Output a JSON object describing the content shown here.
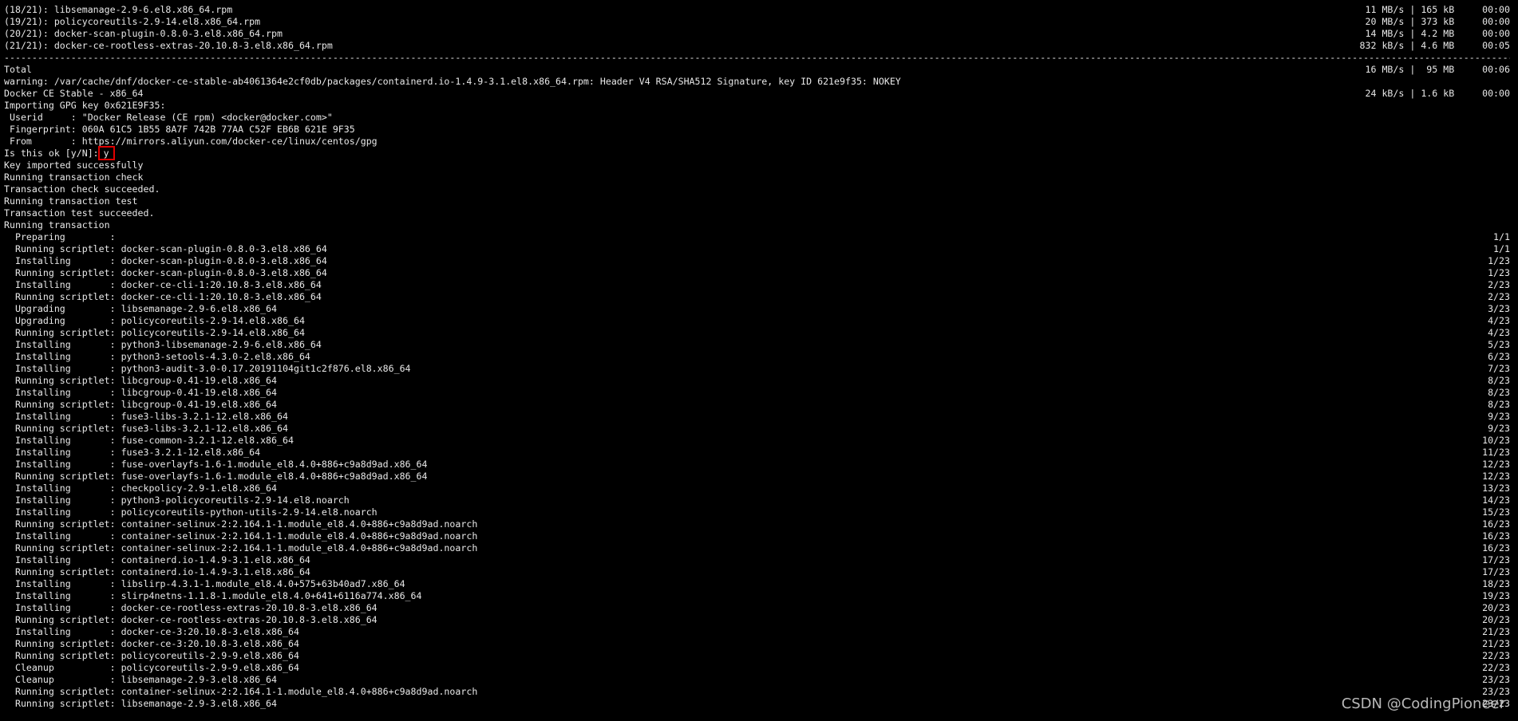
{
  "terminal": {
    "lines": [
      {
        "left": "(18/21): libsemanage-2.9-6.el8.x86_64.rpm",
        "right": "11 MB/s | 165 kB     00:00"
      },
      {
        "left": "(19/21): policycoreutils-2.9-14.el8.x86_64.rpm",
        "right": "20 MB/s | 373 kB     00:00"
      },
      {
        "left": "(20/21): docker-scan-plugin-0.8.0-3.el8.x86_64.rpm",
        "right": "14 MB/s | 4.2 MB     00:00"
      },
      {
        "left": "(21/21): docker-ce-rootless-extras-20.10.8-3.el8.x86_64.rpm",
        "right": "832 kB/s | 4.6 MB     00:05"
      },
      {
        "type": "separator",
        "text": "--------------------------------------------------------------------------------------------------------------------------------------------------------------------------------------------------------------------------------------------------------------------------------------------------------------------------------------------------------------"
      },
      {
        "left": "Total",
        "right": "16 MB/s |  95 MB     00:06"
      },
      {
        "left": "warning: /var/cache/dnf/docker-ce-stable-ab4061364e2cf0db/packages/containerd.io-1.4.9-3.1.el8.x86_64.rpm: Header V4 RSA/SHA512 Signature, key ID 621e9f35: NOKEY",
        "right": ""
      },
      {
        "left": "Docker CE Stable - x86_64",
        "right": "24 kB/s | 1.6 kB     00:00"
      },
      {
        "left": "Importing GPG key 0x621E9F35:",
        "right": ""
      },
      {
        "left": " Userid     : \"Docker Release (CE rpm) <docker@docker.com>\"",
        "right": ""
      },
      {
        "left": " Fingerprint: 060A 61C5 1B55 8A7F 742B 77AA C52F EB6B 621E 9F35",
        "right": ""
      },
      {
        "left": " From       : https://mirrors.aliyun.com/docker-ce/linux/centos/gpg",
        "right": ""
      },
      {
        "type": "prompt",
        "left": "Is this ok [y/N]:",
        "answer": "y"
      },
      {
        "left": "Key imported successfully",
        "right": ""
      },
      {
        "left": "Running transaction check",
        "right": ""
      },
      {
        "left": "Transaction check succeeded.",
        "right": ""
      },
      {
        "left": "Running transaction test",
        "right": ""
      },
      {
        "left": "Transaction test succeeded.",
        "right": ""
      },
      {
        "left": "Running transaction",
        "right": ""
      },
      {
        "left": "  Preparing        :",
        "right": "1/1"
      },
      {
        "left": "  Running scriptlet: docker-scan-plugin-0.8.0-3.el8.x86_64",
        "right": "1/1"
      },
      {
        "left": "  Installing       : docker-scan-plugin-0.8.0-3.el8.x86_64",
        "right": "1/23"
      },
      {
        "left": "  Running scriptlet: docker-scan-plugin-0.8.0-3.el8.x86_64",
        "right": "1/23"
      },
      {
        "left": "  Installing       : docker-ce-cli-1:20.10.8-3.el8.x86_64",
        "right": "2/23"
      },
      {
        "left": "  Running scriptlet: docker-ce-cli-1:20.10.8-3.el8.x86_64",
        "right": "2/23"
      },
      {
        "left": "  Upgrading        : libsemanage-2.9-6.el8.x86_64",
        "right": "3/23"
      },
      {
        "left": "  Upgrading        : policycoreutils-2.9-14.el8.x86_64",
        "right": "4/23"
      },
      {
        "left": "  Running scriptlet: policycoreutils-2.9-14.el8.x86_64",
        "right": "4/23"
      },
      {
        "left": "  Installing       : python3-libsemanage-2.9-6.el8.x86_64",
        "right": "5/23"
      },
      {
        "left": "  Installing       : python3-setools-4.3.0-2.el8.x86_64",
        "right": "6/23"
      },
      {
        "left": "  Installing       : python3-audit-3.0-0.17.20191104git1c2f876.el8.x86_64",
        "right": "7/23"
      },
      {
        "left": "  Running scriptlet: libcgroup-0.41-19.el8.x86_64",
        "right": "8/23"
      },
      {
        "left": "  Installing       : libcgroup-0.41-19.el8.x86_64",
        "right": "8/23"
      },
      {
        "left": "  Running scriptlet: libcgroup-0.41-19.el8.x86_64",
        "right": "8/23"
      },
      {
        "left": "  Installing       : fuse3-libs-3.2.1-12.el8.x86_64",
        "right": "9/23"
      },
      {
        "left": "  Running scriptlet: fuse3-libs-3.2.1-12.el8.x86_64",
        "right": "9/23"
      },
      {
        "left": "  Installing       : fuse-common-3.2.1-12.el8.x86_64",
        "right": "10/23"
      },
      {
        "left": "  Installing       : fuse3-3.2.1-12.el8.x86_64",
        "right": "11/23"
      },
      {
        "left": "  Installing       : fuse-overlayfs-1.6-1.module_el8.4.0+886+c9a8d9ad.x86_64",
        "right": "12/23"
      },
      {
        "left": "  Running scriptlet: fuse-overlayfs-1.6-1.module_el8.4.0+886+c9a8d9ad.x86_64",
        "right": "12/23"
      },
      {
        "left": "  Installing       : checkpolicy-2.9-1.el8.x86_64",
        "right": "13/23"
      },
      {
        "left": "  Installing       : python3-policycoreutils-2.9-14.el8.noarch",
        "right": "14/23"
      },
      {
        "left": "  Installing       : policycoreutils-python-utils-2.9-14.el8.noarch",
        "right": "15/23"
      },
      {
        "left": "  Running scriptlet: container-selinux-2:2.164.1-1.module_el8.4.0+886+c9a8d9ad.noarch",
        "right": "16/23"
      },
      {
        "left": "  Installing       : container-selinux-2:2.164.1-1.module_el8.4.0+886+c9a8d9ad.noarch",
        "right": "16/23"
      },
      {
        "left": "  Running scriptlet: container-selinux-2:2.164.1-1.module_el8.4.0+886+c9a8d9ad.noarch",
        "right": "16/23"
      },
      {
        "left": "  Installing       : containerd.io-1.4.9-3.1.el8.x86_64",
        "right": "17/23"
      },
      {
        "left": "  Running scriptlet: containerd.io-1.4.9-3.1.el8.x86_64",
        "right": "17/23"
      },
      {
        "left": "  Installing       : libslirp-4.3.1-1.module_el8.4.0+575+63b40ad7.x86_64",
        "right": "18/23"
      },
      {
        "left": "  Installing       : slirp4netns-1.1.8-1.module_el8.4.0+641+6116a774.x86_64",
        "right": "19/23"
      },
      {
        "left": "  Installing       : docker-ce-rootless-extras-20.10.8-3.el8.x86_64",
        "right": "20/23"
      },
      {
        "left": "  Running scriptlet: docker-ce-rootless-extras-20.10.8-3.el8.x86_64",
        "right": "20/23"
      },
      {
        "left": "  Installing       : docker-ce-3:20.10.8-3.el8.x86_64",
        "right": "21/23"
      },
      {
        "left": "  Running scriptlet: docker-ce-3:20.10.8-3.el8.x86_64",
        "right": "21/23"
      },
      {
        "left": "  Running scriptlet: policycoreutils-2.9-9.el8.x86_64",
        "right": "22/23"
      },
      {
        "left": "  Cleanup          : policycoreutils-2.9-9.el8.x86_64",
        "right": "22/23"
      },
      {
        "left": "  Cleanup          : libsemanage-2.9-3.el8.x86_64",
        "right": "23/23"
      },
      {
        "left": "  Running scriptlet: container-selinux-2:2.164.1-1.module_el8.4.0+886+c9a8d9ad.noarch",
        "right": "23/23"
      },
      {
        "left": "  Running scriptlet: libsemanage-2.9-3.el8.x86_64",
        "right": "23/23"
      }
    ]
  },
  "watermark": {
    "text": "CSDN @CodingPioneer"
  },
  "colors": {
    "background": "#000000",
    "text": "#e8e8e8",
    "highlight_box": "#e00000"
  }
}
